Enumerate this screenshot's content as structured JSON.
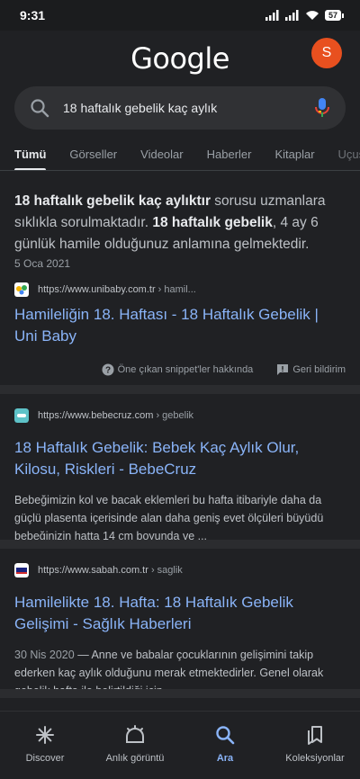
{
  "status_bar": {
    "time": "9:31",
    "battery": "57"
  },
  "header": {
    "logo": "Google",
    "avatar_letter": "S"
  },
  "search": {
    "query": "18 haftalık gebelik kaç aylık"
  },
  "tabs": [
    {
      "label": "Tümü"
    },
    {
      "label": "Görseller"
    },
    {
      "label": "Videolar"
    },
    {
      "label": "Haberler"
    },
    {
      "label": "Kitaplar"
    },
    {
      "label": "Uçuş Ar"
    }
  ],
  "featured_snippet": {
    "text_bold_1": "18 haftalık gebelik kaç aylıktır",
    "text_1": " sorusu uzmanlara sıklıkla sorulmaktadır. ",
    "text_bold_2": "18 haftalık gebelik",
    "text_2": ", 4 ay 6 günlük hamile olduğunuz anlamına gelmektedir.",
    "date": "5 Oca 2021",
    "site": "https://www.unibaby.com.tr",
    "crumb": " › hamil...",
    "title": "Hamileliğin 18. Haftası - 18 Haftalık Gebelik | Uni Baby",
    "about_label": "Öne çıkan snippet'ler hakkında",
    "feedback_label": "Geri bildirim"
  },
  "results": [
    {
      "site": "https://www.bebecruz.com",
      "crumb": " › gebelik",
      "title": "18 Haftalık Gebelik: Bebek Kaç Aylık Olur, Kilosu, Riskleri - BebeCruz",
      "date": "",
      "description": "Bebeğimizin kol ve bacak eklemleri bu hafta itibariyle daha da güçlü plasenta içerisinde alan daha geniş evet ölçüleri büyüdü bebeğinizin hatta 14 cm boyunda ve ..."
    },
    {
      "site": "https://www.sabah.com.tr",
      "crumb": " › saglik",
      "title": "Hamilelikte 18. Hafta: 18 Haftalık Gebelik Gelişimi - Sağlık Haberleri",
      "date": "30 Nis 2020",
      "description": " — Anne ve babalar çocuklarının gelişimini takip ederken kaç aylık olduğunu merak etmektedirler. Genel olarak gebelik hafta ile belirtildiği için ..."
    }
  ],
  "bottom_nav": [
    {
      "label": "Discover"
    },
    {
      "label": "Anlık görüntü"
    },
    {
      "label": "Ara"
    },
    {
      "label": "Koleksiyonlar"
    }
  ],
  "colors": {
    "background": "#202124",
    "link": "#8ab4f8",
    "avatar": "#e8501f"
  }
}
